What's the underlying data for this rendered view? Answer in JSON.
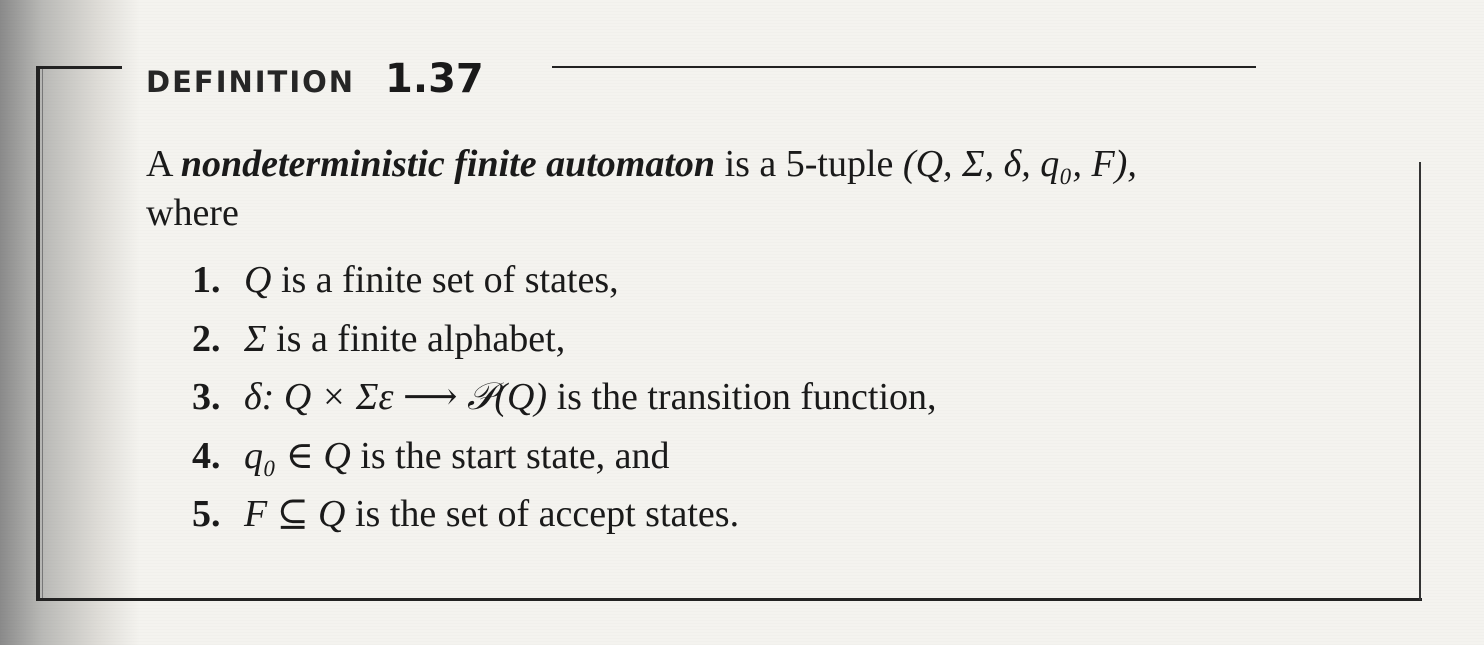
{
  "definition": {
    "label": "DEFINITION",
    "number": "1.37"
  },
  "intro": {
    "lead": "A",
    "term": "nondeterministic finite automaton",
    "middle": "is a 5-tuple",
    "tuple": "(Q, Σ, δ, q₀, F),",
    "tail": "where"
  },
  "items": [
    {
      "num": "1.",
      "math": "Q",
      "text": "is a finite set of states,"
    },
    {
      "num": "2.",
      "math": "Σ",
      "text": "is a finite alphabet,"
    },
    {
      "num": "3.",
      "math": "δ: Q × Σε ⟶ 𝒫(Q)",
      "text": "is the transition function,"
    },
    {
      "num": "4.",
      "math": "q₀ ∈ Q",
      "text": "is the start state, and"
    },
    {
      "num": "5.",
      "math": "F ⊆ Q",
      "text": "is the set of accept states."
    }
  ]
}
